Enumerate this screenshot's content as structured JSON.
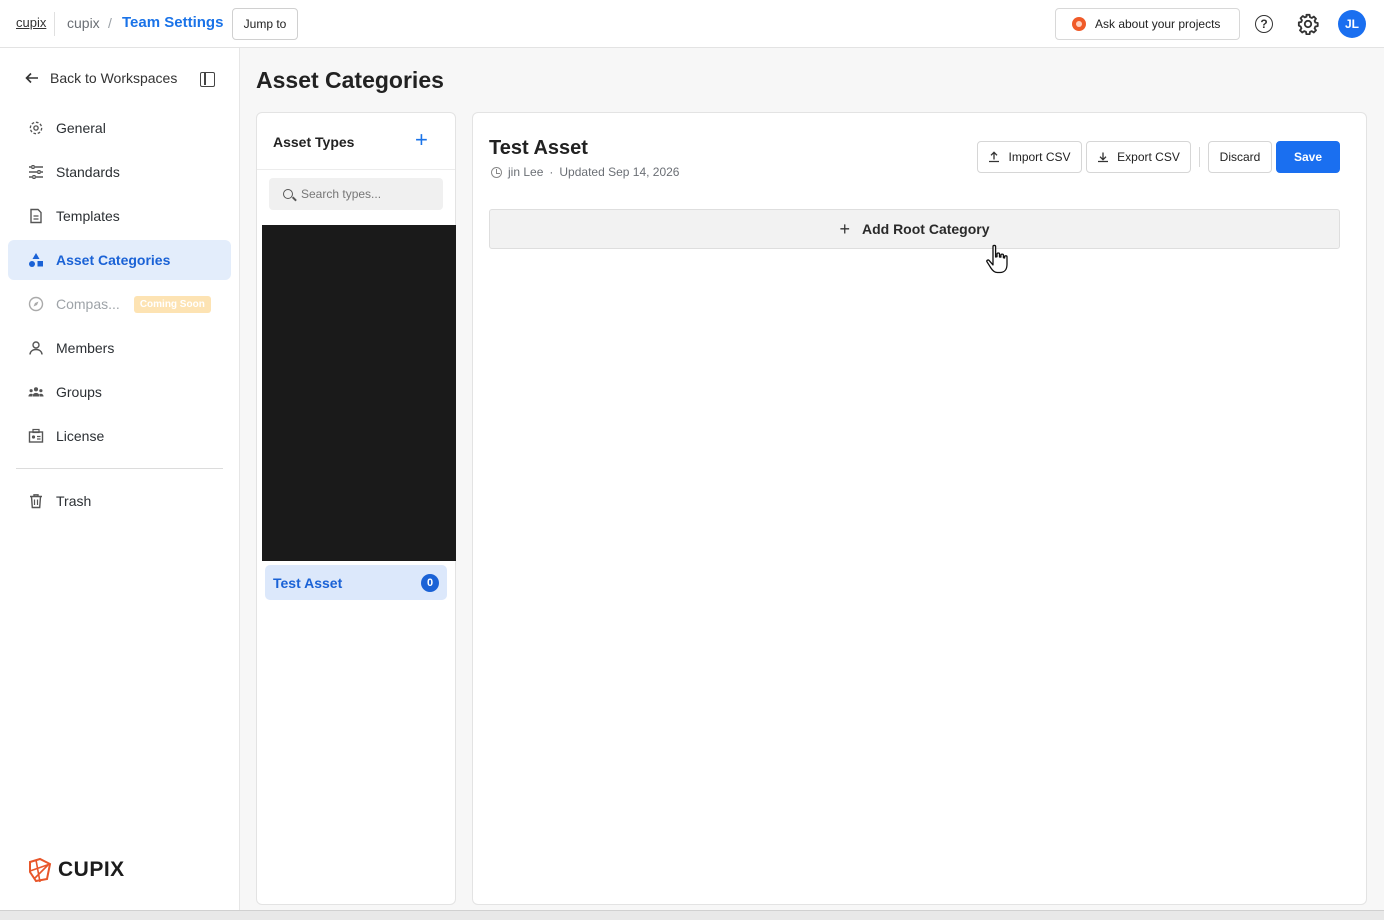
{
  "header": {
    "logo_text": "cupix",
    "workspace": "cupix",
    "separator": "/",
    "current_page": "Team Settings",
    "jump_label": "Jump to",
    "ask_label": "Ask about your projects",
    "help_glyph": "?",
    "avatar_initials": "JL"
  },
  "sidebar": {
    "back_label": "Back to Workspaces",
    "items": [
      {
        "label": "General",
        "icon": "gear-icon"
      },
      {
        "label": "Standards",
        "icon": "sliders-icon"
      },
      {
        "label": "Templates",
        "icon": "document-icon"
      },
      {
        "label": "Asset Categories",
        "icon": "shapes-icon",
        "active": true
      },
      {
        "label": "Compas...",
        "icon": "compass-icon",
        "disabled": true,
        "badge": "Coming Soon"
      },
      {
        "label": "Members",
        "icon": "person-icon"
      },
      {
        "label": "Groups",
        "icon": "group-icon"
      },
      {
        "label": "License",
        "icon": "license-icon"
      }
    ],
    "trash_label": "Trash",
    "brand": "CUPIX"
  },
  "main": {
    "title": "Asset Categories",
    "types_panel": {
      "title": "Asset Types",
      "add_glyph": "+",
      "search_placeholder": "Search types...",
      "items": [
        {
          "label": "Test Asset",
          "count": "0"
        }
      ]
    },
    "detail": {
      "title": "Test Asset",
      "author": "jin Lee",
      "dot": "·",
      "updated": "Updated Sep 14, 2026",
      "import_label": "Import CSV",
      "export_label": "Export CSV",
      "discard_label": "Discard",
      "save_label": "Save",
      "add_root_label": "Add Root Category",
      "add_glyph": "+"
    }
  },
  "colors": {
    "accent": "#1a6ff0",
    "active_bg": "#e3edfb",
    "badge_bg": "#fde3b3"
  }
}
